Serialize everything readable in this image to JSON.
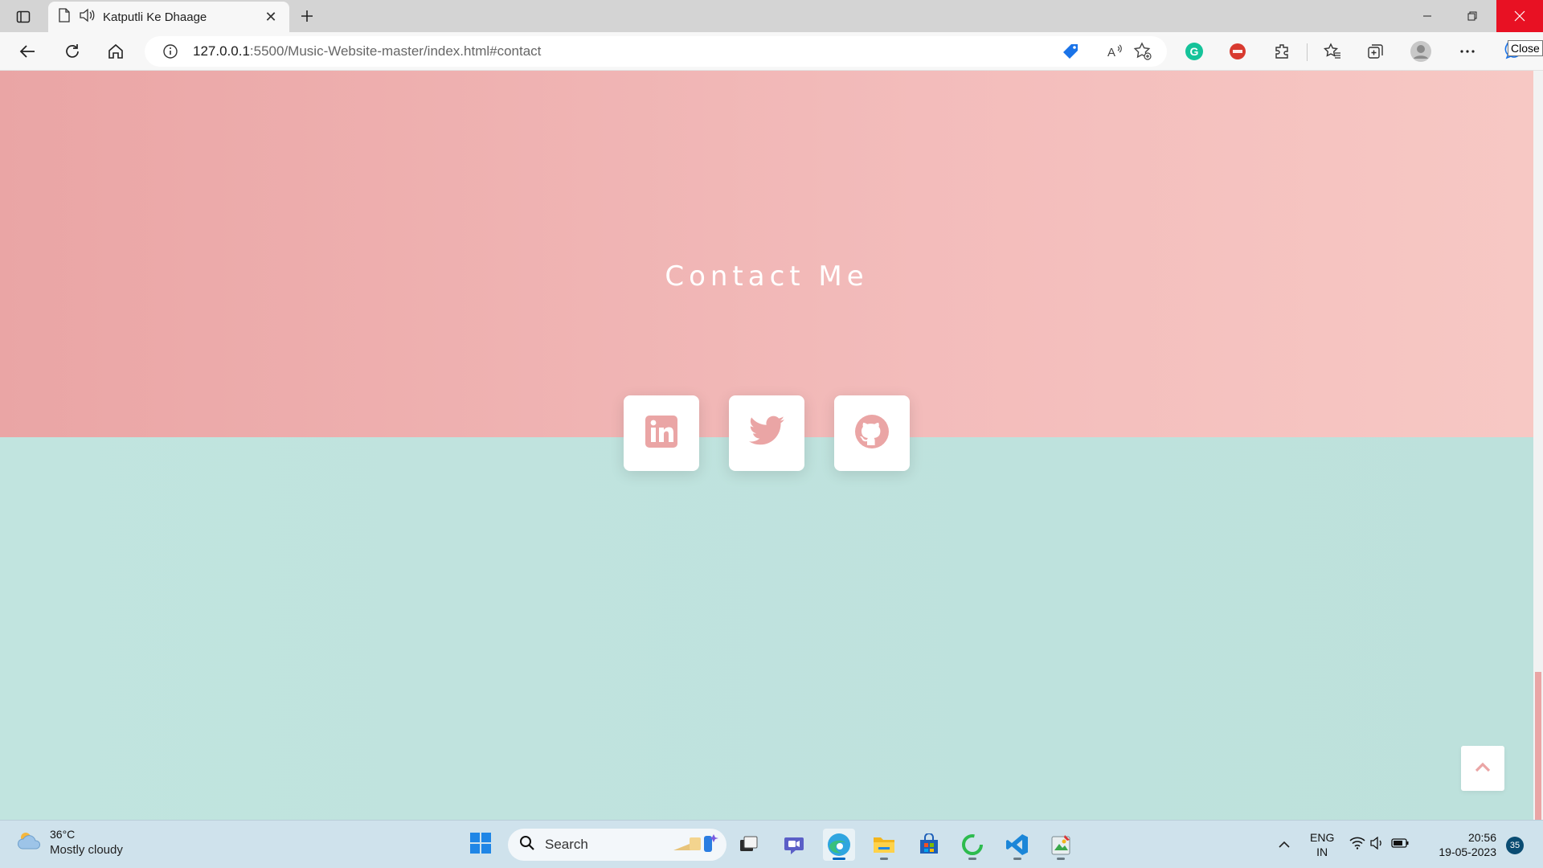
{
  "browser": {
    "tab_title": "Katputli Ke Dhaage",
    "url_host": "127.0.0.1",
    "url_rest": ":5500/Music-Website-master/index.html#contact",
    "close_tooltip": "Close"
  },
  "page": {
    "contact_title": "Contact Me",
    "social": [
      {
        "name": "linkedin-icon"
      },
      {
        "name": "twitter-icon"
      },
      {
        "name": "github-icon"
      }
    ],
    "accent_color": "#eaa5a5",
    "mint_color": "#c1e4df"
  },
  "taskbar": {
    "weather_temp": "36°C",
    "weather_cond": "Mostly cloudy",
    "search_label": "Search",
    "lang_line1": "ENG",
    "lang_line2": "IN",
    "time": "20:56",
    "date": "19-05-2023",
    "notification_count": "35"
  }
}
